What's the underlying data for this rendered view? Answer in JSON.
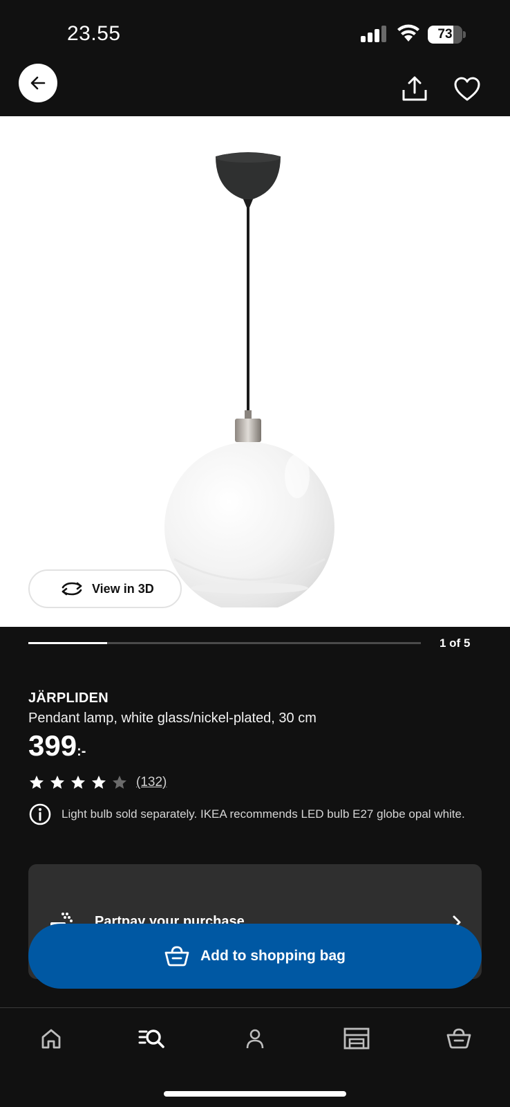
{
  "status_bar": {
    "time": "23.55",
    "battery": "73",
    "battery_level": 0.73
  },
  "header": {
    "back_icon": "arrow-left-icon",
    "share_icon": "share-icon",
    "favorite_icon": "heart-icon"
  },
  "gallery": {
    "view3d_label": "View in 3D",
    "view3d_icon": "rotate-icon",
    "current": 1,
    "total": 5,
    "page_label": "1 of 5"
  },
  "product": {
    "name": "JÄRPLIDEN",
    "description": "Pendant lamp, white glass/nickel-plated, 30 cm",
    "price": "399",
    "price_suffix": ":-",
    "rating": 4,
    "rating_max": 5,
    "review_count": "(132)",
    "info_text": "Light bulb sold separately. IKEA recommends LED bulb E27 globe opal white."
  },
  "partpay": {
    "label": "Partpay your purchase"
  },
  "cta": {
    "add_label": "Add to shopping bag"
  },
  "tabs": [
    {
      "icon": "home-icon"
    },
    {
      "icon": "search-icon"
    },
    {
      "icon": "profile-icon"
    },
    {
      "icon": "store-icon"
    },
    {
      "icon": "shopping-bag-icon"
    }
  ],
  "colors": {
    "background": "#111111",
    "primary_blue": "#0058a3",
    "card": "#2f2f2f",
    "white": "#ffffff"
  }
}
